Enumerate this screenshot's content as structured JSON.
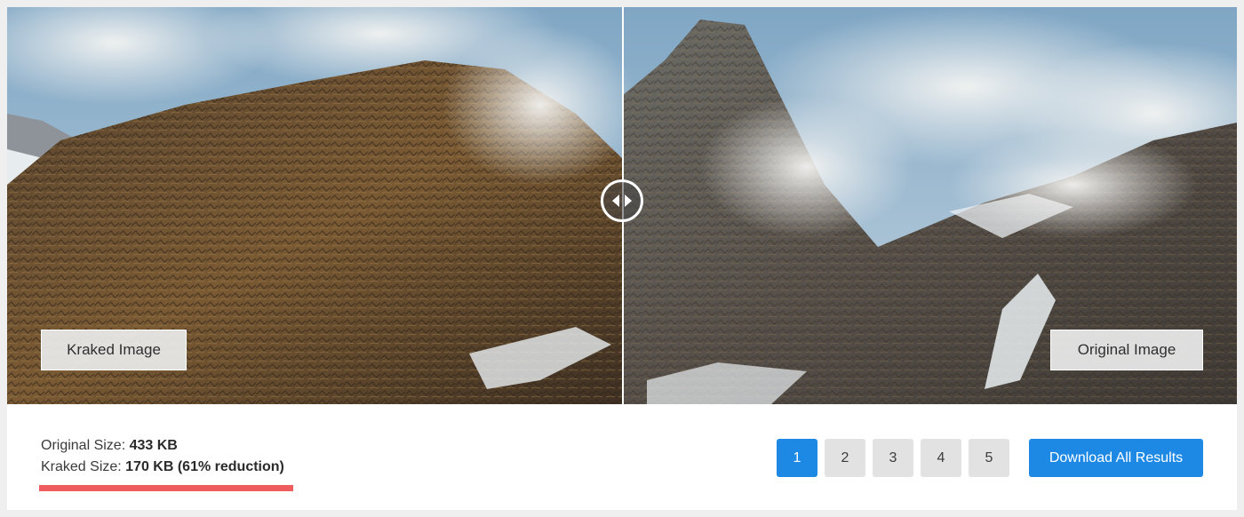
{
  "comparison": {
    "left_label": "Kraked Image",
    "right_label": "Original Image",
    "slider_handle": "left-right-arrows-icon"
  },
  "stats": {
    "original_label": "Original Size:",
    "original_value": "433 KB",
    "kraked_label": "Kraked Size:",
    "kraked_value": "170 KB (61% reduction)"
  },
  "pagination": {
    "pages": [
      "1",
      "2",
      "3",
      "4",
      "5"
    ],
    "active": "1"
  },
  "actions": {
    "download_label": "Download All Results"
  },
  "colors": {
    "accent": "#1e88e5",
    "highlight": "#f05d5e"
  }
}
